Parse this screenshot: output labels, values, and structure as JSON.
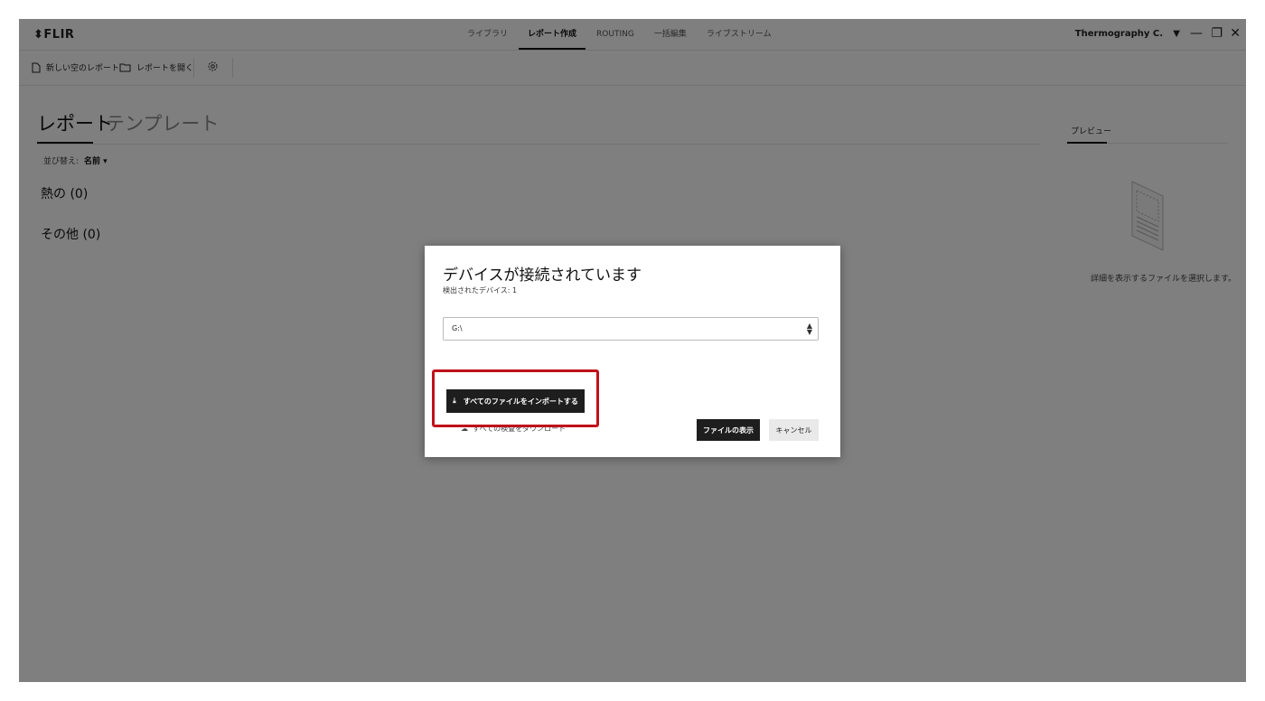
{
  "app": {
    "logo": "FLIR"
  },
  "nav": {
    "tabs": [
      {
        "label": "ライブラリ",
        "active": false
      },
      {
        "label": "レポート作成",
        "active": true
      },
      {
        "label": "ROUTING",
        "active": false
      },
      {
        "label": "一括編集",
        "active": false
      },
      {
        "label": "ライブストリーム",
        "active": false
      }
    ]
  },
  "user": {
    "name": "Thermography C."
  },
  "window_controls": {
    "minimize": "—",
    "restore": "❐",
    "close": "✕"
  },
  "toolbar": {
    "new_report": "新しい空のレポート",
    "open_report": "レポートを開く"
  },
  "main": {
    "tabs": [
      {
        "label": "レポート"
      },
      {
        "label": "テンプレート"
      }
    ],
    "sort_label": "並び替え:",
    "sort_value": "名前 ▾",
    "groups": [
      {
        "label": "熱の (0)"
      },
      {
        "label": "その他 (0)"
      }
    ]
  },
  "preview": {
    "title": "プレビュー",
    "message": "詳細を表示するファイルを選択します。"
  },
  "dialog": {
    "title": "デバイスが接続されています",
    "subtitle": "検出されたデバイス: 1",
    "selected_device": "G:\\",
    "import_all": "すべてのファイルをインポートする",
    "download_all": "すべての検査をダウンロード",
    "show_files": "ファイルの表示",
    "cancel": "キャンセル"
  },
  "colors": {
    "highlight": "#c0111a",
    "primary_button": "#1e1e1e"
  }
}
